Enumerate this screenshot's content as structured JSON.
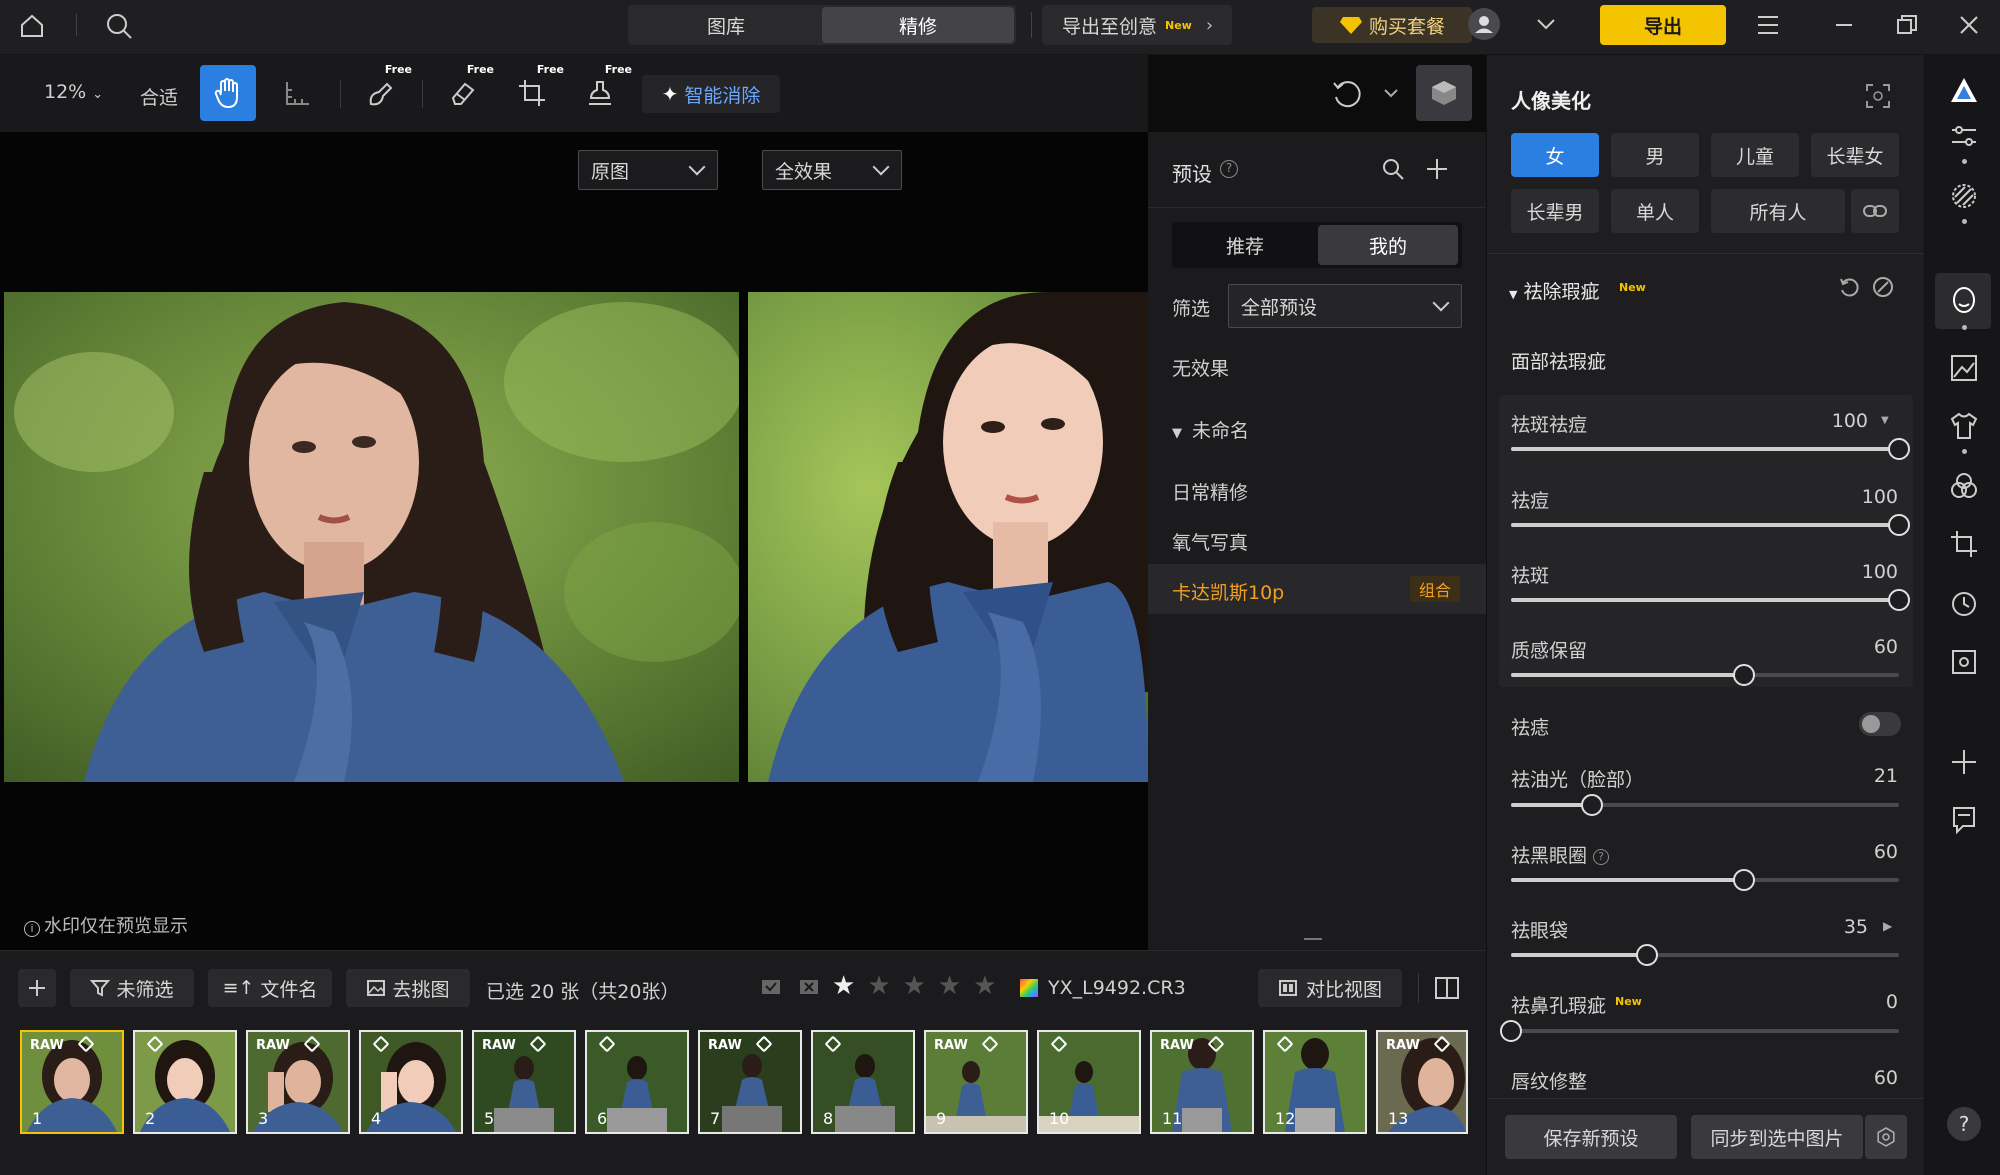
{
  "titlebar": {
    "tabs": [
      "图库",
      "精修"
    ],
    "active_tab": "精修",
    "export_creative": "导出至创意",
    "new_badge": "New",
    "buy_package": "购买套餐",
    "export_button": "导出"
  },
  "toolbar": {
    "zoom": "12%",
    "fit": "合适",
    "free_label": "Free",
    "smart_erase": "智能消除"
  },
  "canvas": {
    "view_select": "原图",
    "effect_select": "全效果",
    "watermark_note": "水印仅在预览显示"
  },
  "presets": {
    "title": "预设",
    "tab_recommend": "推荐",
    "tab_mine": "我的",
    "filter_label": "筛选",
    "filter_value": "全部预设",
    "items": {
      "no_effect": "无效果",
      "group_untitled": "未命名",
      "daily": "日常精修",
      "oxygen": "氧气写真",
      "cadakas": "卡达凯斯10p",
      "combo_badge": "组合"
    }
  },
  "bottombar": {
    "unfiltered": "未筛选",
    "filename": "文件名",
    "pick_pic": "去挑图",
    "selected_count": "已选 20 张（共20张）",
    "current_file": "YX_L9492.CR3",
    "compare_view": "对比视图",
    "rating_stars": 1,
    "thumbnails": [
      {
        "num": "1",
        "raw": "RAW"
      },
      {
        "num": "2",
        "raw": ""
      },
      {
        "num": "3",
        "raw": "RAW"
      },
      {
        "num": "4",
        "raw": ""
      },
      {
        "num": "5",
        "raw": "RAW"
      },
      {
        "num": "6",
        "raw": ""
      },
      {
        "num": "7",
        "raw": "RAW"
      },
      {
        "num": "8",
        "raw": ""
      },
      {
        "num": "9",
        "raw": "RAW"
      },
      {
        "num": "10",
        "raw": ""
      },
      {
        "num": "11",
        "raw": "RAW"
      },
      {
        "num": "12",
        "raw": ""
      },
      {
        "num": "13",
        "raw": "RAW"
      }
    ]
  },
  "panel": {
    "title": "人像美化",
    "people": [
      "女",
      "男",
      "儿童",
      "长辈女",
      "长辈男",
      "单人",
      "所有人"
    ],
    "active_person": "女",
    "section": "祛除瑕疵",
    "section_badge": "New",
    "subsection": "面部祛瑕疵",
    "sliders": [
      {
        "label": "祛斑祛痘",
        "value": "100",
        "ratio": 1.0
      },
      {
        "label": "祛痘",
        "value": "100",
        "ratio": 1.0
      },
      {
        "label": "祛斑",
        "value": "100",
        "ratio": 1.0
      },
      {
        "label": "质感保留",
        "value": "60",
        "ratio": 0.6
      }
    ],
    "mole_label": "祛痣",
    "mole_toggle": false,
    "sliders2": [
      {
        "label": "祛油光（脸部）",
        "value": "21",
        "ratio": 0.21
      },
      {
        "label": "祛黑眼圈",
        "value": "60",
        "ratio": 0.6
      },
      {
        "label": "祛眼袋",
        "value": "35",
        "ratio": 0.35
      },
      {
        "label": "祛鼻孔瑕疵",
        "value": "0",
        "ratio": 0.0,
        "badge": "New"
      },
      {
        "label": "唇纹修整",
        "value": "60",
        "ratio": 0.6
      }
    ],
    "save_preset": "保存新预设",
    "sync": "同步到选中图片"
  },
  "colors": {
    "accent_blue": "#2b7fe0",
    "accent_yellow": "#f5c400",
    "orange_text": "#f0a020"
  }
}
